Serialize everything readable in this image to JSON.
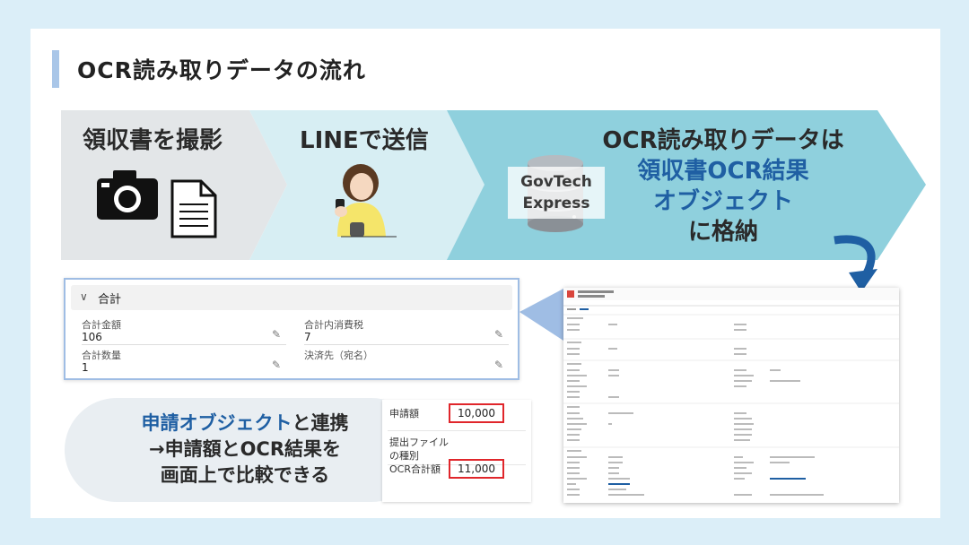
{
  "title": "OCR読み取りデータの流れ",
  "flow": {
    "step1": {
      "label": "領収書を撮影"
    },
    "step2": {
      "label": "LINEで送信"
    },
    "step3": {
      "line1": "OCR読み取りデータは",
      "line2": "領収書OCR結果",
      "line3": "オブジェクト",
      "line4": "に格納",
      "db_line1": "GovTech",
      "db_line2": "Express"
    }
  },
  "summary_panel": {
    "section": "合計",
    "fields": [
      {
        "label": "合計金額",
        "value": "106"
      },
      {
        "label": "合計内消費税",
        "value": "7"
      },
      {
        "label": "合計数量",
        "value": "1"
      },
      {
        "label": "決済先（宛名）",
        "value": ""
      }
    ]
  },
  "callout": {
    "blue": "申請オブジェクト",
    "rest1": "と連携",
    "line2": "→申請額とOCR結果を",
    "line3": "画面上で比較できる"
  },
  "compare": {
    "application_label": "申請額",
    "application_value": "10,000",
    "file_type_label_1": "提出ファイル",
    "file_type_label_2": "の種別",
    "ocr_label": "OCR合計額",
    "ocr_value": "11,000"
  },
  "colors": {
    "accent_blue": "#1f5fa3",
    "highlight_red": "#e0262b",
    "arrow_gray": "#e3e6e8",
    "arrow_teal": "#8fd0dd"
  }
}
